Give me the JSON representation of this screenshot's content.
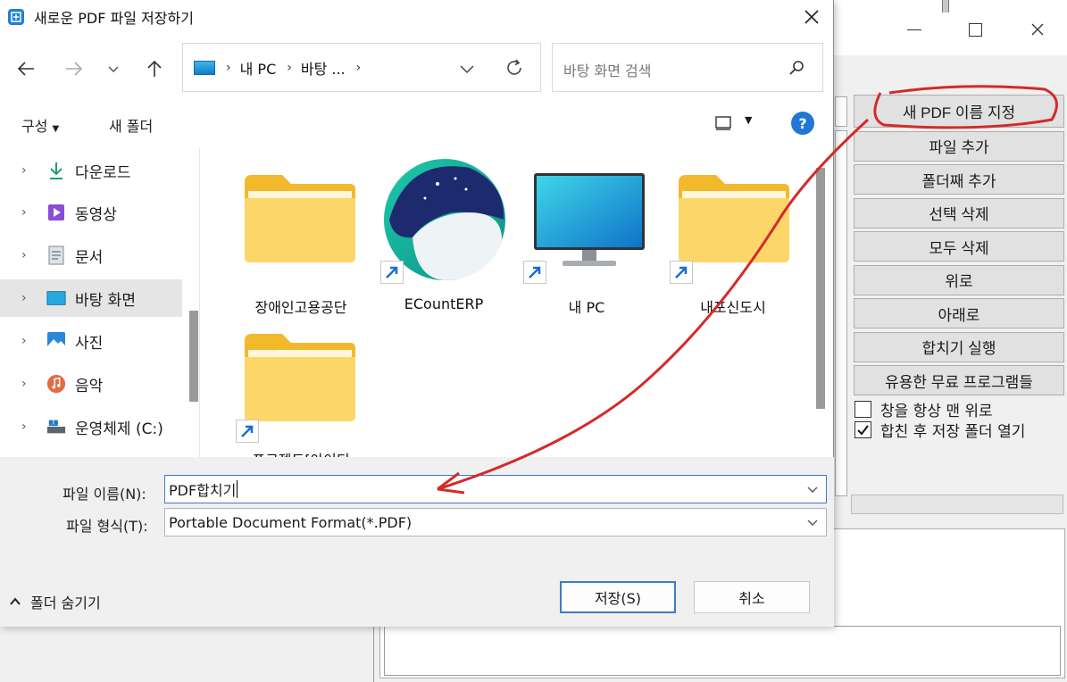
{
  "background_app": {
    "buttons": [
      "새 PDF 이름 지정",
      "파일 추가",
      "폴더째 추가",
      "선택 삭제",
      "모두 삭제",
      "위로",
      "아래로",
      "합치기 실행",
      "유용한 무료 프로그램들"
    ],
    "checkboxes": [
      {
        "label": "창을 항상 맨 위로",
        "checked": false
      },
      {
        "label": "합친 후 저장 폴더 열기",
        "checked": true
      }
    ],
    "annotation_color": "#d42a2a"
  },
  "dialog": {
    "title": "새로운 PDF 파일 저장하기",
    "breadcrumb": [
      "내 PC",
      "바탕 ..."
    ],
    "search_placeholder": "바탕 화면 검색",
    "toolbar": {
      "organize": "구성",
      "new_folder": "새 폴더",
      "help": "?"
    },
    "nav_items": [
      {
        "label": "다운로드",
        "icon": "download-icon",
        "selected": false
      },
      {
        "label": "동영상",
        "icon": "video-icon",
        "selected": false
      },
      {
        "label": "문서",
        "icon": "document-icon",
        "selected": false
      },
      {
        "label": "바탕 화면",
        "icon": "desktop-icon",
        "selected": true
      },
      {
        "label": "사진",
        "icon": "picture-icon",
        "selected": false
      },
      {
        "label": "음악",
        "icon": "music-icon",
        "selected": false
      },
      {
        "label": "운영체제 (C:)",
        "icon": "drive-icon",
        "selected": false
      }
    ],
    "files": [
      {
        "name": "장애인고용공단",
        "type": "folder",
        "shortcut": false
      },
      {
        "name": "ECountERP",
        "type": "app",
        "shortcut": true
      },
      {
        "name": "내 PC",
        "type": "pc",
        "shortcut": true
      },
      {
        "name": "내포신도시",
        "type": "folder",
        "shortcut": true
      },
      {
        "name": "프로젝트[아이티",
        "type": "folder",
        "shortcut": true
      }
    ],
    "filename_label": "파일 이름(N):",
    "filename_value": "PDF합치기",
    "filetype_label": "파일 형식(T):",
    "filetype_value": "Portable Document Format(*.PDF)",
    "hide_folders": "폴더 숨기기",
    "save_button": "저장(S)",
    "cancel_button": "취소"
  }
}
